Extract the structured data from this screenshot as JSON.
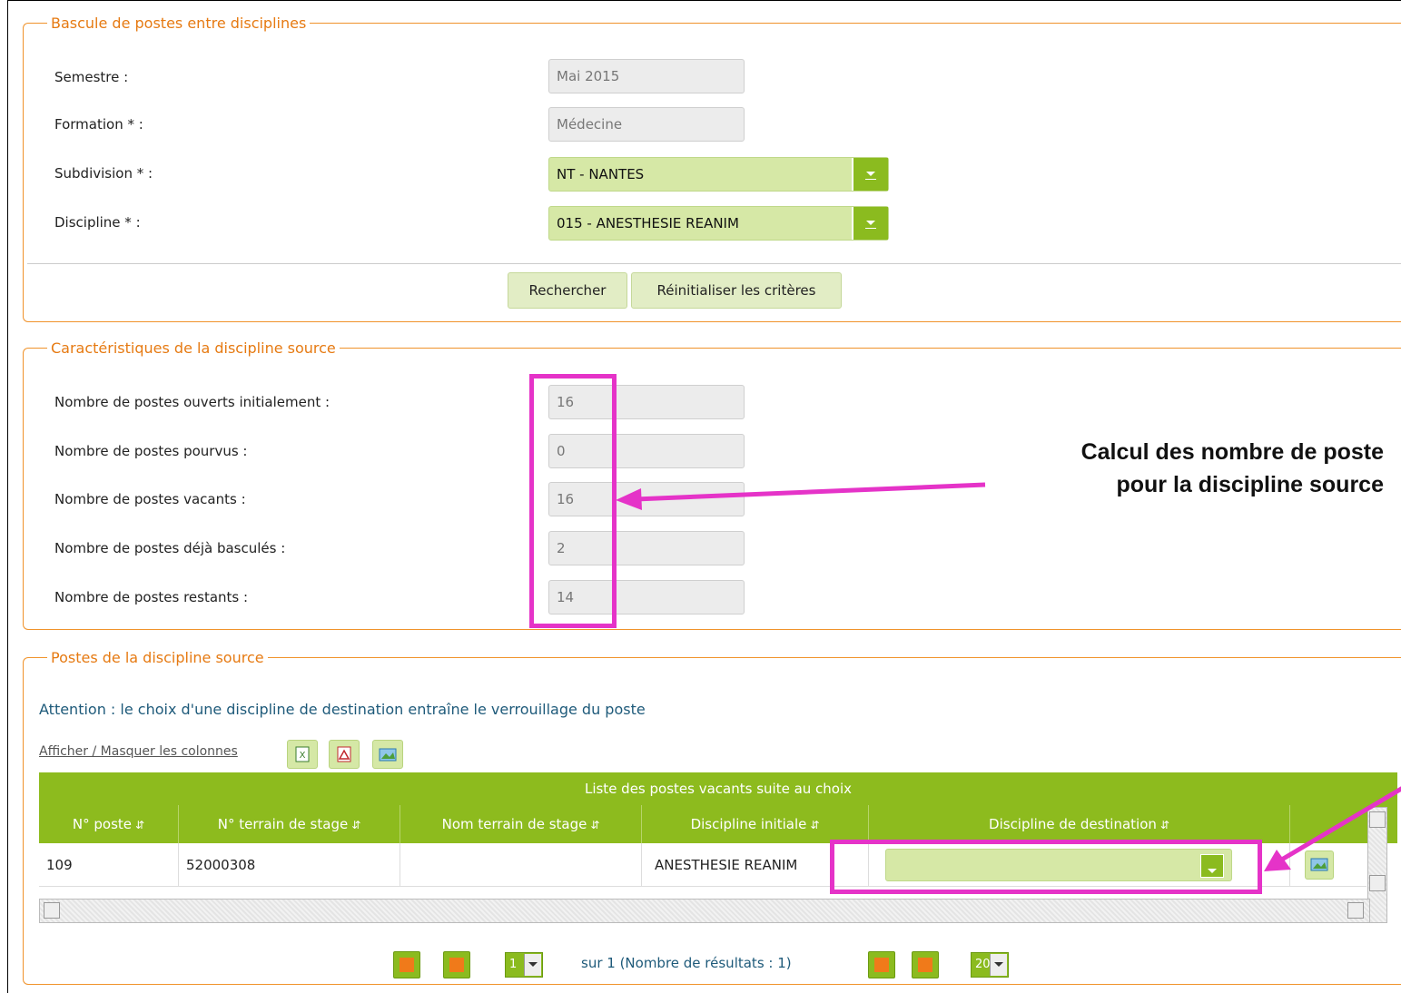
{
  "section1": {
    "legend": "Bascule de postes entre disciplines",
    "semestre_label": "Semestre :",
    "semestre_value": "Mai 2015",
    "formation_label": "Formation * :",
    "formation_value": "Médecine",
    "subdivision_label": "Subdivision * :",
    "subdivision_value": "NT - NANTES",
    "discipline_label": "Discipline * :",
    "discipline_value": "015 - ANESTHESIE REANIM",
    "search_button": "Rechercher",
    "reset_button": "Réinitialiser les critères"
  },
  "section2": {
    "legend": "Caractéristiques de la discipline source",
    "fields": [
      {
        "label": "Nombre de postes ouverts initialement :",
        "value": "16"
      },
      {
        "label": "Nombre de postes pourvus :",
        "value": "0"
      },
      {
        "label": "Nombre de postes vacants :",
        "value": "16"
      },
      {
        "label": "Nombre de postes déjà basculés :",
        "value": "2"
      },
      {
        "label": "Nombre de postes restants :",
        "value": "14"
      }
    ]
  },
  "annotation": {
    "line1": "Calcul des nombre de poste",
    "line2": "pour la discipline source",
    "color": "#e533c8"
  },
  "section3": {
    "legend": "Postes de la discipline source",
    "warning": "Attention : le choix d'une discipline de destination entraîne le verrouillage du poste",
    "toggle_columns": "Afficher / Masquer les colonnes",
    "table_title": "Liste des postes vacants suite au choix",
    "columns": [
      "N° poste",
      "N° terrain de stage",
      "Nom terrain de stage",
      "Discipline initiale",
      "Discipline de destination"
    ],
    "rows": [
      {
        "poste": "109",
        "terrain": "52000308",
        "nom": "",
        "discipline": "ANESTHESIE REANIM",
        "destination": ""
      }
    ],
    "pagination": {
      "page": "1",
      "info": "sur 1 (Nombre de résultats : 1)",
      "page_size": "20"
    }
  },
  "colors": {
    "accent": "#8dbb1e",
    "legend": "#e67a12",
    "highlight": "#e533c8"
  }
}
